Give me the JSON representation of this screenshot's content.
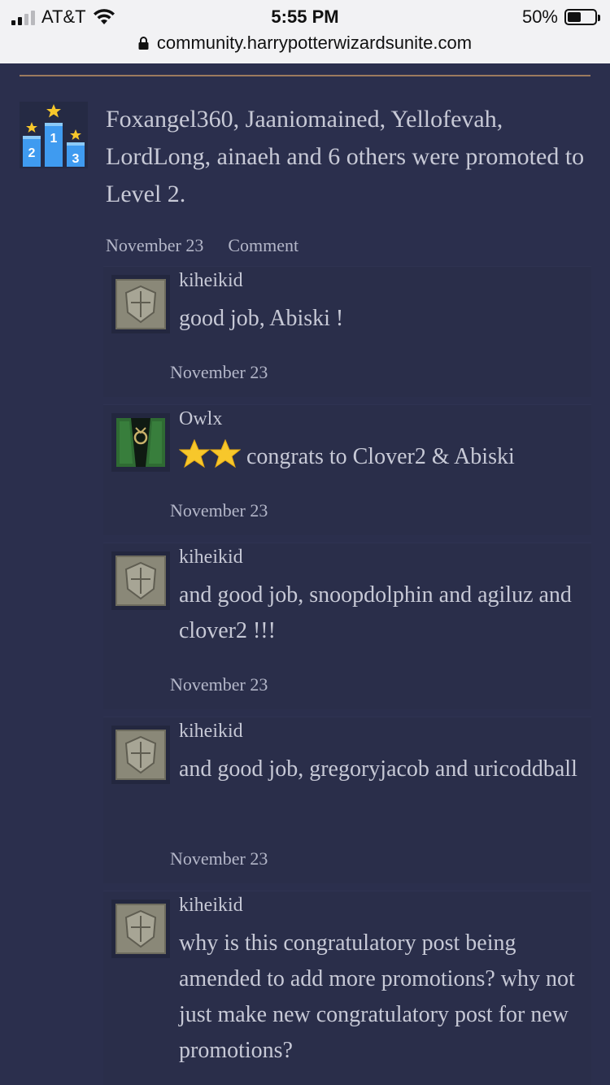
{
  "status": {
    "carrier": "AT&T",
    "time": "5:55 PM",
    "battery": "50%",
    "battery_level": 0.5,
    "url": "community.harrypotterwizardsunite.com"
  },
  "post": {
    "icon": "podium-ranking-icon",
    "text": "Foxangel360, Jaaniomained, Yellofevah, LordLong, ainaeh and 6 others were promoted to Level 2.",
    "date": "November 23",
    "comment_label": "Comment"
  },
  "comments": [
    {
      "author": "kiheikid",
      "text": "good job, Abiski !",
      "date": "November 23",
      "avatar": "hogwarts-crest-avatar"
    },
    {
      "author": "Owlx",
      "text": "congrats to Clover2 & Abiski",
      "prefix_icons": [
        "star-emoji",
        "star-emoji"
      ],
      "date": "November 23",
      "avatar": "slytherin-robe-avatar"
    },
    {
      "author": "kiheikid",
      "text": "and good job, snoopdolphin and agiluz and clover2 !!!",
      "date": "November 23",
      "avatar": "hogwarts-crest-avatar"
    },
    {
      "author": "kiheikid",
      "text": "and good job, gregoryjacob and uricoddball",
      "date": "November 23",
      "avatar": "hogwarts-crest-avatar"
    },
    {
      "author": "kiheikid",
      "text": "why is this congratulatory post being amended to add more promotions? why not just make new congratulatory post for new promotions?",
      "avatar": "hogwarts-crest-avatar"
    }
  ]
}
